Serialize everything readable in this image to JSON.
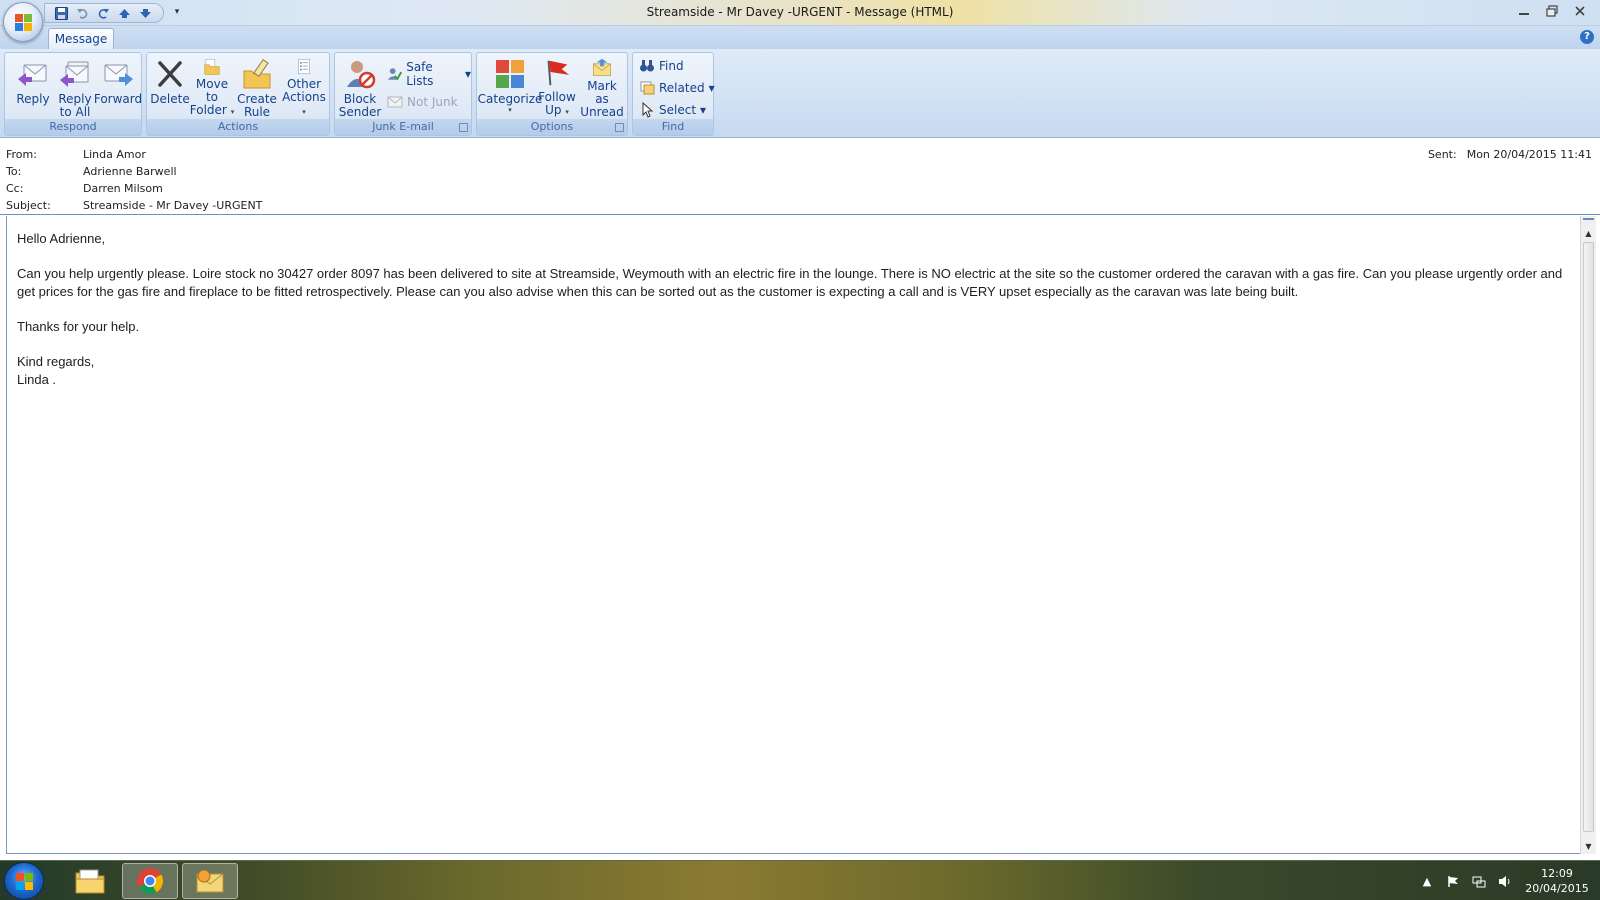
{
  "window": {
    "title": "Streamside - Mr Davey -URGENT - Message (HTML)"
  },
  "ribbon": {
    "tab": "Message",
    "groups": {
      "respond": {
        "label": "Respond",
        "reply": "Reply",
        "reply_all_1": "Reply",
        "reply_all_2": "to All",
        "forward": "Forward"
      },
      "actions": {
        "label": "Actions",
        "delete": "Delete",
        "move_1": "Move to",
        "move_2": "Folder",
        "rule_1": "Create",
        "rule_2": "Rule",
        "other_1": "Other",
        "other_2": "Actions"
      },
      "junk": {
        "label": "Junk E-mail",
        "block_1": "Block",
        "block_2": "Sender",
        "safe_lists": "Safe Lists",
        "not_junk": "Not Junk"
      },
      "options": {
        "label": "Options",
        "categorize": "Categorize",
        "follow_1": "Follow",
        "follow_2": "Up",
        "mark_1": "Mark as",
        "mark_2": "Unread"
      },
      "find": {
        "label": "Find",
        "find": "Find",
        "related": "Related",
        "select": "Select"
      }
    }
  },
  "header": {
    "from_label": "From:",
    "from": "Linda Amor",
    "to_label": "To:",
    "to": "Adrienne Barwell",
    "cc_label": "Cc:",
    "cc": "Darren Milsom",
    "subject_label": "Subject:",
    "subject": "Streamside - Mr Davey -URGENT",
    "sent_label": "Sent:",
    "sent": "Mon 20/04/2015 11:41"
  },
  "body": {
    "greeting": "Hello Adrienne,",
    "paragraph": "Can you help urgently please.  Loire stock no 30427 order 8097 has been delivered to site at Streamside, Weymouth with an electric fire in the lounge.  There is NO electric at the site so the customer ordered the caravan with a gas fire.  Can you please urgently order and get prices for the gas fire and fireplace to be fitted retrospectively.  Please can you also advise when this can be sorted out as the customer is expecting a call and is VERY upset especially as the caravan was late being built.",
    "thanks": "Thanks for your help.",
    "closing": "Kind regards,",
    "signature": "Linda ."
  },
  "taskbar": {
    "time": "12:09",
    "date": "20/04/2015"
  },
  "colors": {
    "ribbon_text": "#15428b",
    "group_label": "#3e6aa8",
    "accent": "#2f6fc4"
  }
}
